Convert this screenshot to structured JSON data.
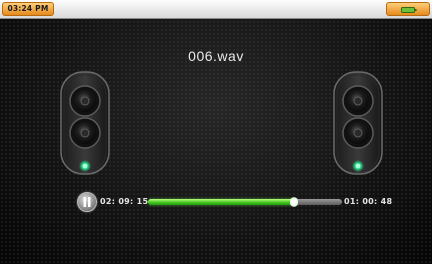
{
  "status_bar": {
    "clock": "03:24 PM",
    "battery_icon": "battery-icon"
  },
  "player": {
    "title": "006.wav",
    "state": "playing",
    "play_pause_icon": "pause-icon",
    "elapsed": "02: 09: 15",
    "remaining": "01: 00: 48",
    "progress_fraction": 0.75
  },
  "colors": {
    "accent_orange": "#e58a1c",
    "progress_green": "#3fc51d",
    "speaker_led": "#22e08a"
  }
}
